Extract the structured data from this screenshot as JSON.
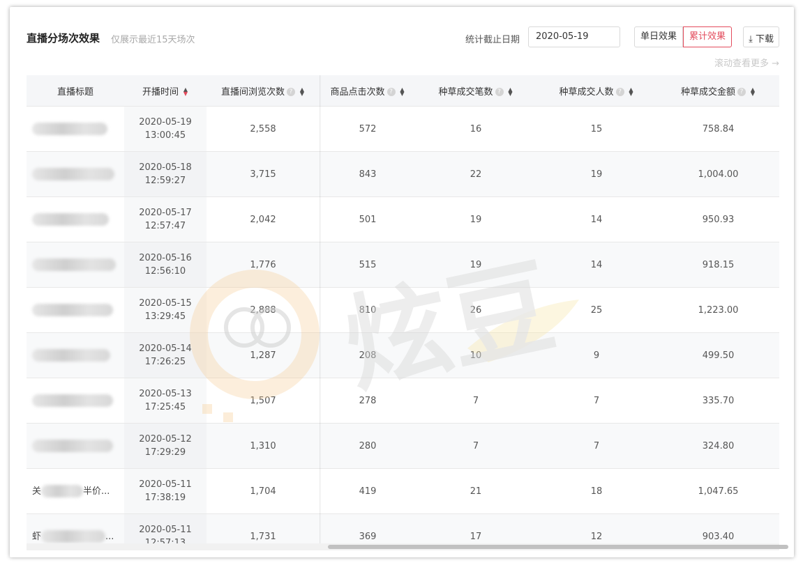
{
  "header": {
    "title": "直播分场次效果",
    "subtitle": "仅展示最近15天场次",
    "date_label": "统计截止日期",
    "date_value": "2020-05-19",
    "btn_single": "单日效果",
    "btn_cumulative": "累计效果",
    "download": "下载",
    "scroll_more": "滚动查看更多"
  },
  "table": {
    "columns": [
      "直播标题",
      "开播时间",
      "直播间浏览次数",
      "商品点击次数",
      "种草成交笔数",
      "种草成交人数",
      "种草成交金额"
    ],
    "rows": [
      {
        "title": "",
        "date": "2020-05-19",
        "time": "13:00:45",
        "views": "2,558",
        "clicks": "572",
        "orders": "16",
        "buyers": "15",
        "amount": "758.84"
      },
      {
        "title": "",
        "date": "2020-05-18",
        "time": "12:59:27",
        "views": "3,715",
        "clicks": "843",
        "orders": "22",
        "buyers": "19",
        "amount": "1,004.00"
      },
      {
        "title": "",
        "date": "2020-05-17",
        "time": "12:57:47",
        "views": "2,042",
        "clicks": "501",
        "orders": "19",
        "buyers": "14",
        "amount": "950.93"
      },
      {
        "title": "",
        "date": "2020-05-16",
        "time": "12:56:10",
        "views": "1,776",
        "clicks": "515",
        "orders": "19",
        "buyers": "14",
        "amount": "918.15"
      },
      {
        "title": "",
        "date": "2020-05-15",
        "time": "13:29:45",
        "views": "2,888",
        "clicks": "810",
        "orders": "26",
        "buyers": "25",
        "amount": "1,223.00"
      },
      {
        "title": "",
        "date": "2020-05-14",
        "time": "17:26:25",
        "views": "1,287",
        "clicks": "208",
        "orders": "10",
        "buyers": "9",
        "amount": "499.50"
      },
      {
        "title": "",
        "date": "2020-05-13",
        "time": "17:25:45",
        "views": "1,507",
        "clicks": "278",
        "orders": "7",
        "buyers": "7",
        "amount": "335.70"
      },
      {
        "title": "",
        "date": "2020-05-12",
        "time": "17:29:29",
        "views": "1,310",
        "clicks": "280",
        "orders": "7",
        "buyers": "7",
        "amount": "324.80"
      },
      {
        "title_prefix": "关",
        "title": "半价...",
        "date": "2020-05-11",
        "time": "17:38:19",
        "views": "1,704",
        "clicks": "419",
        "orders": "21",
        "buyers": "18",
        "amount": "1,047.65"
      },
      {
        "title_prefix": "虾",
        "title": "...",
        "date": "2020-05-11",
        "time": "12:57:13",
        "views": "1,731",
        "clicks": "369",
        "orders": "17",
        "buyers": "12",
        "amount": "903.40"
      }
    ]
  },
  "watermark": {
    "text": "炫豆"
  },
  "colors": {
    "accent": "#e34b5c",
    "header_bg": "#f5f6f8"
  }
}
